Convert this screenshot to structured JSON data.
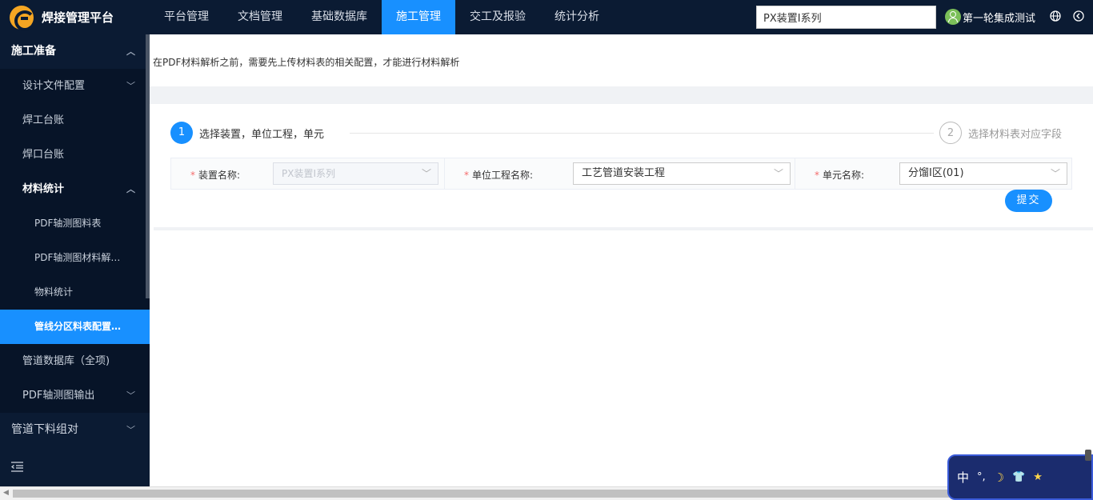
{
  "app": {
    "name": "焊接管理平台"
  },
  "nav": [
    {
      "label": "平台管理",
      "active": false
    },
    {
      "label": "文档管理",
      "active": false
    },
    {
      "label": "基础数据库",
      "active": false
    },
    {
      "label": "施工管理",
      "active": true
    },
    {
      "label": "交工及报验",
      "active": false
    },
    {
      "label": "统计分析",
      "active": false
    }
  ],
  "search": {
    "value": "PX装置I系列"
  },
  "user": {
    "name": "第一轮集成测试"
  },
  "sidebar": {
    "items": [
      {
        "label": "施工准备",
        "level": 1,
        "chevron": "up"
      },
      {
        "label": "设计文件配置",
        "level": 2,
        "chevron": "down"
      },
      {
        "label": "焊工台账",
        "level": 2
      },
      {
        "label": "焊口台账",
        "level": 2
      },
      {
        "label": "材料统计",
        "level": 2,
        "chevron": "up"
      },
      {
        "label": "PDF轴测图料表",
        "level": 3
      },
      {
        "label": "PDF轴测图材料解析...",
        "level": 3
      },
      {
        "label": "物料统计",
        "level": 3
      },
      {
        "label": "管线分区料表配置及...",
        "level": 3,
        "active": true
      },
      {
        "label": "管道数据库（全项)",
        "level": 2
      },
      {
        "label": "PDF轴测图输出",
        "level": 2,
        "chevron": "down"
      },
      {
        "label": "管道下料组对",
        "level": 1,
        "chevron": "down"
      }
    ]
  },
  "main": {
    "notice": "在PDF材料解析之前，需要先上传材料表的相关配置，才能进行材料解析",
    "steps": [
      {
        "num": "1",
        "label": "选择装置，单位工程，单元"
      },
      {
        "num": "2",
        "label": "选择材料表对应字段"
      }
    ],
    "form": {
      "device_label": "装置名称:",
      "device_value": "PX装置I系列",
      "unit_project_label": "单位工程名称:",
      "unit_project_value": "工艺管道安装工程",
      "unit_label": "单元名称:",
      "unit_value": "分馏Ⅰ区(01)",
      "required_mark": "*"
    },
    "submit_label": "提交"
  },
  "ime": {
    "mode": "中",
    "items": [
      "°,",
      "☽",
      "👕",
      "★"
    ]
  },
  "colors": {
    "topbar": "#0b1b33",
    "accent": "#1890ff",
    "sidebar_sub": "#071428"
  }
}
